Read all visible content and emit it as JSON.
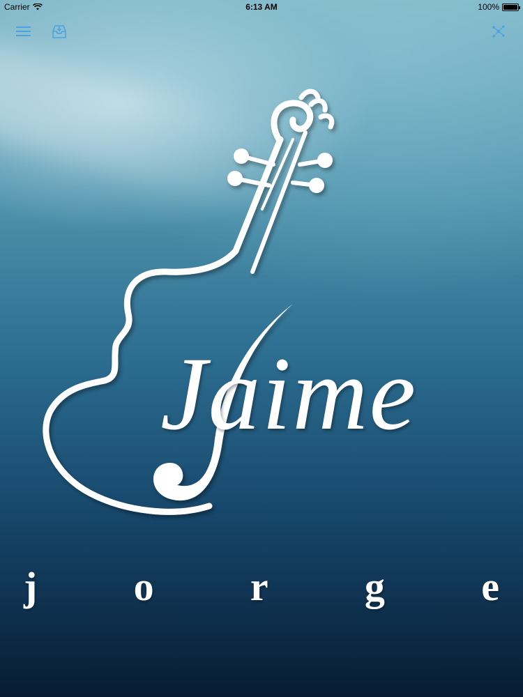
{
  "status_bar": {
    "carrier": "Carrier",
    "time": "6:13 AM",
    "battery": "100%",
    "battery_level": 1.0
  },
  "nav": {
    "left_icons": [
      "menu-icon",
      "inbox-icon"
    ],
    "right_icons": [
      "network-icon"
    ],
    "accent": "#4aa3e0"
  },
  "logo": {
    "first_name": "Jaime",
    "surname_letters": [
      "j",
      "o",
      "r",
      "g",
      "e"
    ],
    "color": "#ffffff"
  }
}
